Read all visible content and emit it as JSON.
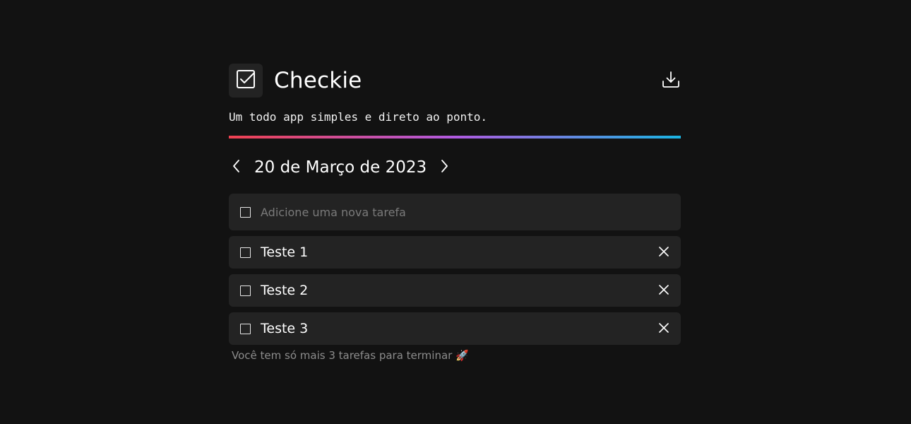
{
  "header": {
    "app_title": "Checkie",
    "tagline": "Um todo app simples e direto ao ponto.",
    "download_icon": "download-icon",
    "logo_icon": "checkbox-checked-icon"
  },
  "colors": {
    "background": "#121212",
    "card": "#232323",
    "gradient_start": "#ef4150",
    "gradient_mid": "#b05ae0",
    "gradient_end": "#1ab4e2",
    "muted_text": "#8c8c8c"
  },
  "date_nav": {
    "date_label": "20 de Março de 2023",
    "prev_icon": "chevron-left-icon",
    "next_icon": "chevron-right-icon"
  },
  "new_task": {
    "placeholder": "Adicione uma nova tarefa",
    "value": ""
  },
  "tasks": [
    {
      "label": "Teste 1",
      "done": false
    },
    {
      "label": "Teste 2",
      "done": false
    },
    {
      "label": "Teste 3",
      "done": false
    }
  ],
  "footer": {
    "remaining_text": "Você tem só mais 3 tarefas para terminar 🚀"
  }
}
